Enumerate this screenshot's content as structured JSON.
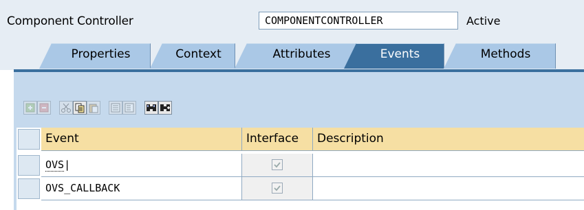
{
  "header": {
    "label": "Component Controller",
    "name_value": "COMPONENTCONTROLLER",
    "status": "Active"
  },
  "tabs": [
    {
      "label": "Properties",
      "active": false
    },
    {
      "label": "Context",
      "active": false
    },
    {
      "label": "Attributes",
      "active": false
    },
    {
      "label": "Events",
      "active": true
    },
    {
      "label": "Methods",
      "active": false
    }
  ],
  "toolbar": {
    "buttons": [
      {
        "icon": "insert-row-icon",
        "enabled": false
      },
      {
        "icon": "delete-row-icon",
        "enabled": false
      },
      {
        "icon": "cut-icon",
        "enabled": false
      },
      {
        "icon": "copy-icon",
        "enabled": true
      },
      {
        "icon": "paste-icon",
        "enabled": false
      },
      {
        "icon": "details-icon",
        "enabled": false
      },
      {
        "icon": "details-2-icon",
        "enabled": false
      },
      {
        "icon": "find-icon",
        "enabled": true
      },
      {
        "icon": "find-next-icon",
        "enabled": true
      }
    ]
  },
  "table": {
    "columns": [
      "Event",
      "Interface",
      "Description"
    ],
    "rows": [
      {
        "event": "OVS",
        "interface": true,
        "description": ""
      },
      {
        "event": "OVS_CALLBACK",
        "interface": true,
        "description": ""
      }
    ]
  },
  "colors": {
    "active_tab": "#3a6f9e",
    "inactive_tab": "#aac8e6",
    "column_header": "#f6dfa3",
    "panel": "#c5d9ed"
  }
}
